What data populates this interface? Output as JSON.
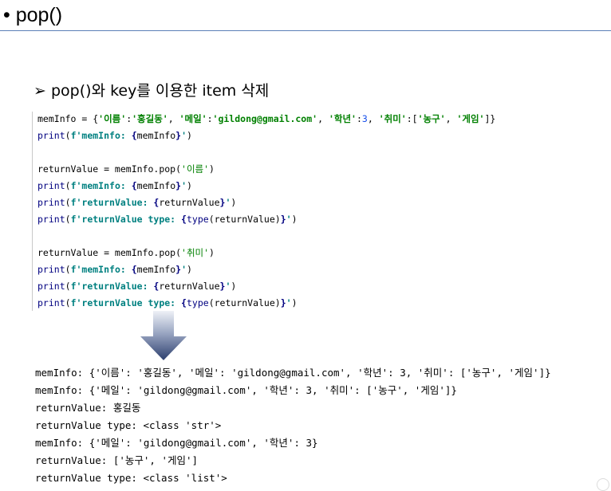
{
  "slide": {
    "title": "• pop()",
    "subheading": "pop()와 key를 이용한 item 삭제",
    "subheading_arrow": "➢"
  },
  "code": {
    "line1": {
      "a": "memInfo = {",
      "b": "'이름'",
      "c": ":",
      "d": "'홍길동'",
      "e": ", ",
      "f": "'메일'",
      "g": ":",
      "h": "'gildong@gmail.com'",
      "i": ", ",
      "j": "'학년'",
      "k": ":",
      "l": "3",
      "m": ", ",
      "n": "'취미'",
      "o": ":[",
      "p": "'농구'",
      "q": ", ",
      "r": "'게임'",
      "s": "]}"
    },
    "line2": {
      "print": "print",
      "open": "(",
      "fstr": "f'memInfo: ",
      "lb": "{",
      "var": "memInfo",
      "rb": "}",
      "end": "'",
      "close": ")"
    },
    "line3": {
      "a": "returnValue = memInfo.pop(",
      "b": "'이름'",
      "c": ")"
    },
    "line4": {
      "print": "print",
      "open": "(",
      "fstr": "f'memInfo: ",
      "lb": "{",
      "var": "memInfo",
      "rb": "}",
      "end": "'",
      "close": ")"
    },
    "line5": {
      "print": "print",
      "open": "(",
      "fstr": "f'returnValue: ",
      "lb": "{",
      "var": "returnValue",
      "rb": "}",
      "end": "'",
      "close": ")"
    },
    "line6": {
      "print": "print",
      "open": "(",
      "fstr": "f'returnValue type: ",
      "lb": "{",
      "builtin": "type",
      "var": "(returnValue)",
      "rb": "}",
      "end": "'",
      "close": ")"
    },
    "line7": {
      "a": "returnValue = memInfo.pop(",
      "b": "'취미'",
      "c": ")"
    },
    "line8": {
      "print": "print",
      "open": "(",
      "fstr": "f'memInfo: ",
      "lb": "{",
      "var": "memInfo",
      "rb": "}",
      "end": "'",
      "close": ")"
    },
    "line9": {
      "print": "print",
      "open": "(",
      "fstr": "f'returnValue: ",
      "lb": "{",
      "var": "returnValue",
      "rb": "}",
      "end": "'",
      "close": ")"
    },
    "line10": {
      "print": "print",
      "open": "(",
      "fstr": "f'returnValue type: ",
      "lb": "{",
      "builtin": "type",
      "var": "(returnValue)",
      "rb": "}",
      "end": "'",
      "close": ")"
    }
  },
  "output": [
    "memInfo: {'이름': '홍길동', '메일': 'gildong@gmail.com', '학년': 3, '취미': ['농구', '게임']}",
    "memInfo: {'메일': 'gildong@gmail.com', '학년': 3, '취미': ['농구', '게임']}",
    "returnValue: 홍길동",
    "returnValue type: <class 'str'>",
    "memInfo: {'메일': 'gildong@gmail.com', '학년': 3}",
    "returnValue: ['농구', '게임']",
    "returnValue type: <class 'list'>"
  ],
  "colors": {
    "title_rule": "#5b7fb7",
    "arrow_top": "#e8ecf4",
    "arrow_bottom": "#2d3f6e",
    "code_print": "#000080",
    "code_fstring": "#008080",
    "code_string": "#008000",
    "code_number": "#1750eb"
  },
  "icons": {
    "down_arrow": "down-arrow-icon",
    "bullet_arrow": "arrow-bullet-icon"
  }
}
